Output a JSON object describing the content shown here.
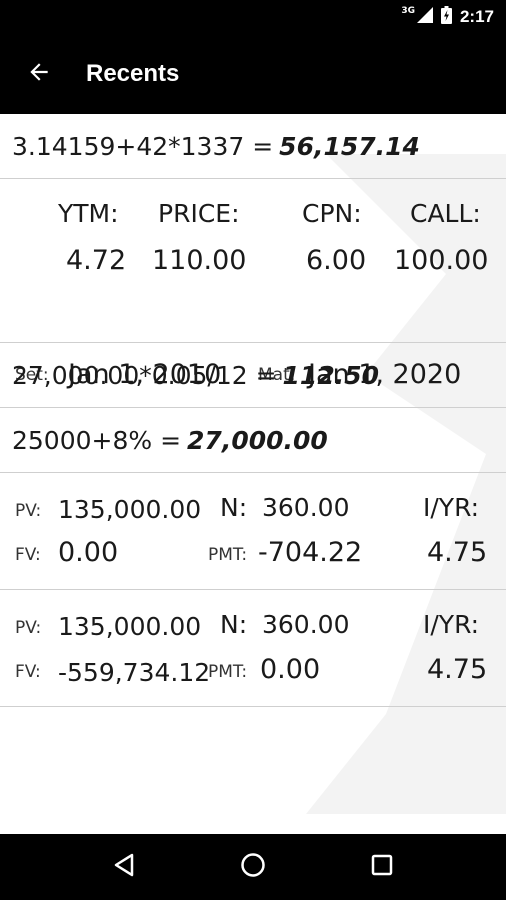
{
  "status_bar": {
    "network": "3G",
    "time": "2:17"
  },
  "app_bar": {
    "title": "Recents"
  },
  "entries": {
    "e1": {
      "expression": "3.14159+42*1337 =",
      "result": "56,157.14"
    },
    "bond": {
      "ytm_label": "YTM:",
      "price_label": "PRICE:",
      "cpn_label": "CPN:",
      "call_label": "CALL:",
      "ytm": "4.72",
      "price": "110.00",
      "cpn": "6.00",
      "call": "100.00",
      "set_label": "Set:",
      "set_date": "Jan 1, 2010",
      "mat_label": "Mat:",
      "mat_date": "Jan 1, 2020"
    },
    "e3": {
      "expression": "27,000.00*0.05/12 =",
      "result": "112.50"
    },
    "e4": {
      "expression": "25000+8% =",
      "result": "27,000.00"
    },
    "tvm1": {
      "pv_label": "PV:",
      "pv": "135,000.00",
      "n_label": "N:",
      "n": "360.00",
      "iyr_label": "I/YR:",
      "fv_label": "FV:",
      "fv": "0.00",
      "pmt_label": "PMT:",
      "pmt": "-704.22",
      "iyr": "4.75"
    },
    "tvm2": {
      "pv_label": "PV:",
      "pv": "135,000.00",
      "n_label": "N:",
      "n": "360.00",
      "iyr_label": "I/YR:",
      "fv_label": "FV:",
      "fv": "-559,734.12",
      "pmt_label": "PMT:",
      "pmt": "0.00",
      "iyr": "4.75"
    }
  },
  "nav": {
    "back": "back-triangle-icon",
    "home": "home-circle-icon",
    "recents": "recents-square-icon"
  },
  "colors": {
    "bar": "#000000",
    "background": "#ffffff",
    "divider": "#cfcfcf",
    "watermark": "#f2f2f2"
  }
}
